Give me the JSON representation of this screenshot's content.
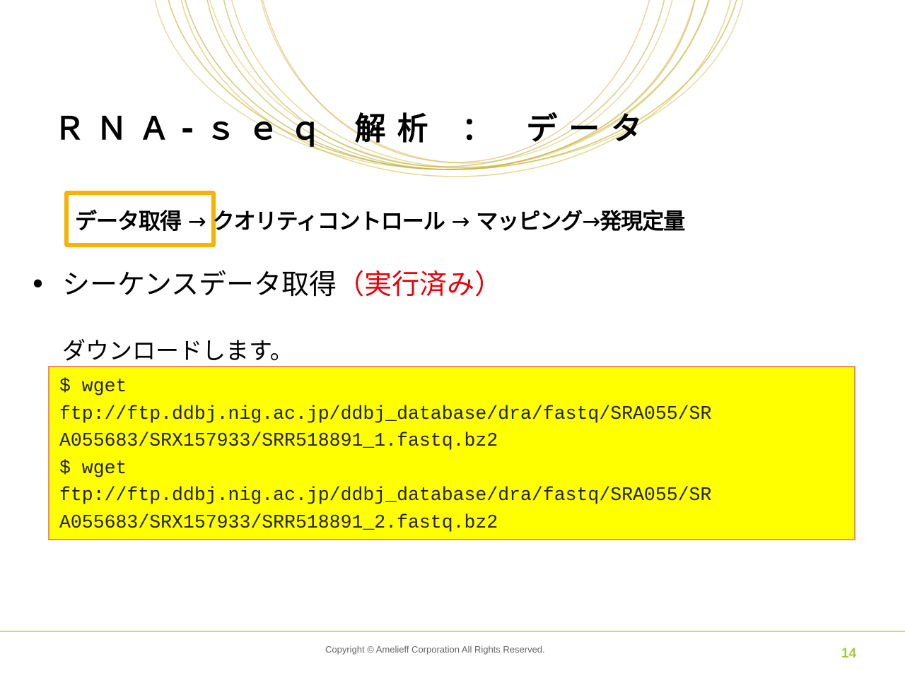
{
  "slide": {
    "title": "ＲＮＡ-ｓｅｑ 解析 ： データ",
    "flow": {
      "step1": "データ取得",
      "arrow1": "→",
      "step2": "クオリティコントロール",
      "arrow2": "→",
      "step3": "マッピング",
      "arrow3": "→",
      "step4": "発現定量"
    },
    "bullet": {
      "symbol": "•",
      "text": "シーケンスデータ取得",
      "status": "（実行済み）"
    },
    "subtext": "ダウンロードします。",
    "code_lines": [
      "$ wget",
      "ftp://ftp.ddbj.nig.ac.jp/ddbj_database/dra/fastq/SRA055/SR",
      "A055683/SRX157933/SRR518891_1.fastq.bz2",
      "$ wget",
      "ftp://ftp.ddbj.nig.ac.jp/ddbj_database/dra/fastq/SRA055/SR",
      "A055683/SRX157933/SRR518891_2.fastq.bz2"
    ],
    "footer": {
      "copyright": "Copyright © Amelieff Corporation All Rights Reserved.",
      "page_number": "14"
    }
  },
  "colors": {
    "highlight_border": "#f4b400",
    "status_text": "#e8000b",
    "code_background": "#ffff00",
    "code_border": "#f0896a",
    "footer_line": "#c8dc6e",
    "page_number": "#a8c83a",
    "ring_stroke": "#c9b53a"
  },
  "icons": {
    "bullet": "bullet-dot"
  }
}
